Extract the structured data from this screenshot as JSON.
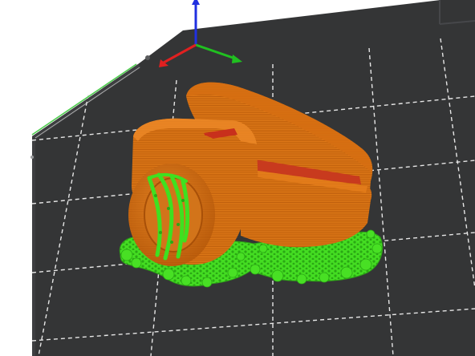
{
  "app": {
    "view": "slicer-preview-3d"
  },
  "scene": {
    "background": "#ffffff",
    "bed_color": "#343536",
    "bed_edge_color": "#262728",
    "grid_color": "#e8e8e8",
    "model_color": "#e07010",
    "model_shadow": "#a84e08",
    "inner_color": "#c83a1e",
    "support_color": "#3fe020",
    "support_shadow": "#22a010",
    "axis_x_color": "#e02020",
    "axis_y_color": "#20c020",
    "axis_z_color": "#2030e0"
  }
}
